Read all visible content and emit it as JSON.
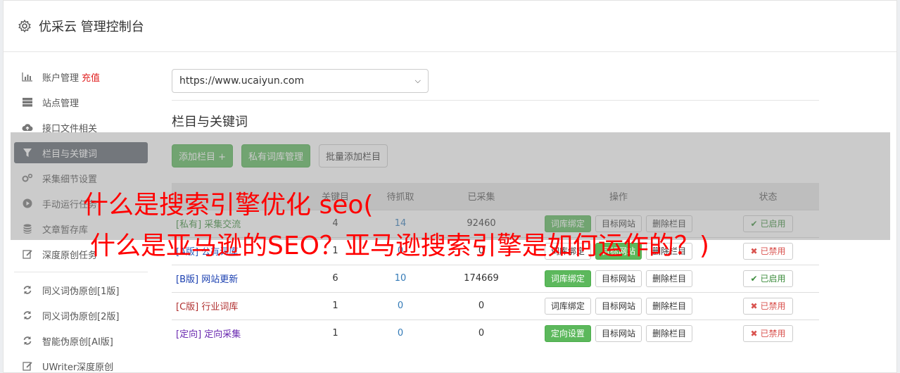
{
  "header": {
    "title": "优采云 管理控制台"
  },
  "sidebar": {
    "items": [
      {
        "label": "账户管理",
        "extra": "充值",
        "icon": "bar-chart-icon"
      },
      {
        "label": "站点管理",
        "icon": "server-icon"
      },
      {
        "label": "接口文件相关",
        "icon": "cloud-upload-icon"
      },
      {
        "label": "栏目与关键词",
        "icon": "filter-icon"
      },
      {
        "label": "采集细节设置",
        "icon": "cogs-icon"
      },
      {
        "label": "手动运行任务",
        "icon": "play-circle-icon"
      },
      {
        "label": "文章暂存库",
        "icon": "database-icon"
      },
      {
        "label": "深度原创任务",
        "icon": "edit-icon"
      },
      {
        "label": "同义词伪原创[1版]",
        "icon": "refresh-icon"
      },
      {
        "label": "同义词伪原创[2版]",
        "icon": "refresh-icon"
      },
      {
        "label": "智能伪原创[AI版]",
        "icon": "refresh-icon"
      },
      {
        "label": "UWriter深度原创",
        "icon": "edit-icon"
      }
    ]
  },
  "main": {
    "site_select": "https://www.ucaiyun.com",
    "section_title": "栏目与关键词",
    "buttons": {
      "add_column": "添加栏目 +",
      "private_lib": "私有词库管理",
      "batch_add": "批量添加栏目"
    },
    "table": {
      "headers": [
        "",
        "关键目",
        "待抓取",
        "已采集",
        "操作",
        "状态"
      ],
      "rows": [
        {
          "tag": "[私有]",
          "name": "采集交流",
          "a": "4",
          "b": "14",
          "c": "92460",
          "op1": "词库绑定",
          "op2": "目标网站",
          "op3": "删除栏目",
          "status": "已启用"
        },
        {
          "tag": "[A版]",
          "name": "公有词库",
          "a": "1",
          "b": "0",
          "c": "0",
          "op1": "词库绑定",
          "op2": "目标网站",
          "op3": "删除栏目",
          "status": "已禁用"
        },
        {
          "tag": "[B版]",
          "name": "网站更新",
          "a": "6",
          "b": "10",
          "c": "174669",
          "op1": "词库绑定",
          "op2": "目标网站",
          "op3": "删除栏目",
          "status": "已启用"
        },
        {
          "tag": "[C版]",
          "name": "行业词库",
          "a": "1",
          "b": "0",
          "c": "0",
          "op1": "词库绑定",
          "op2": "目标网站",
          "op3": "删除栏目",
          "status": "已禁用"
        },
        {
          "tag": "[定向]",
          "name": "定向采集",
          "a": "1",
          "b": "0",
          "c": "0",
          "op1": "定向设置",
          "op2": "目标网站",
          "op3": "删除栏目",
          "status": "已禁用"
        }
      ]
    }
  },
  "watermark": {
    "line1": "什么是搜索引擎优化 seo(",
    "line2": "什么是亚马逊的SEO？亚马逊搜索引擎是如何运作的？)"
  }
}
